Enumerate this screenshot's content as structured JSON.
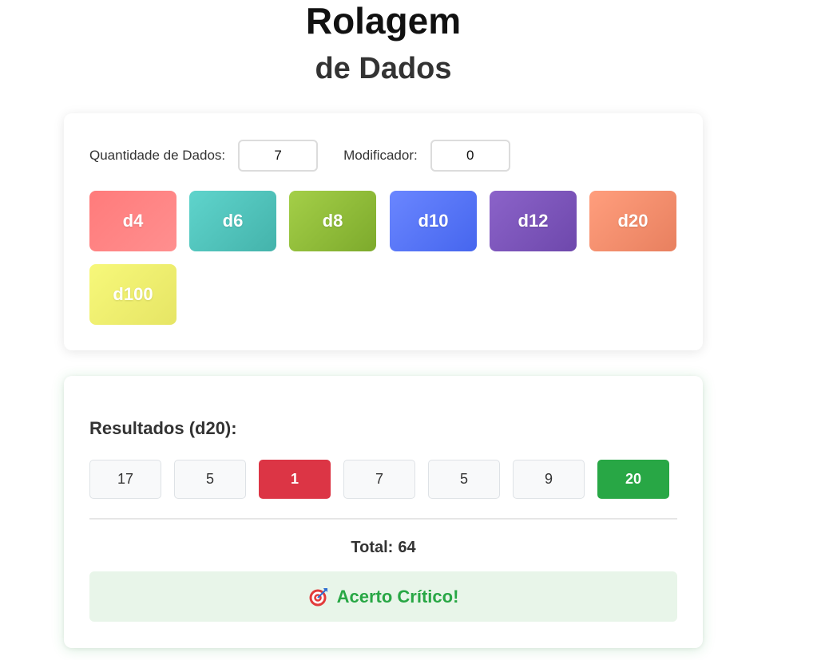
{
  "header": {
    "title_line1": "Rolagem",
    "title_line2": "de Dados"
  },
  "controls": {
    "quantity_label": "Quantidade de Dados:",
    "quantity_value": "7",
    "modifier_label": "Modificador:",
    "modifier_value": "0",
    "dice": [
      "d4",
      "d6",
      "d8",
      "d10",
      "d12",
      "d20",
      "d100"
    ]
  },
  "results": {
    "title": "Resultados (d20):",
    "rolls": [
      "17",
      "5",
      "1",
      "7",
      "5",
      "9",
      "20"
    ],
    "total_label": "Total:",
    "total_value": "64",
    "critical_message": "Acerto Crítico!",
    "critical_icon": "target-icon",
    "colors": {
      "critical_fail": "#dc3545",
      "critical_hit": "#28a745",
      "banner_bg": "#e8f5e9"
    }
  }
}
